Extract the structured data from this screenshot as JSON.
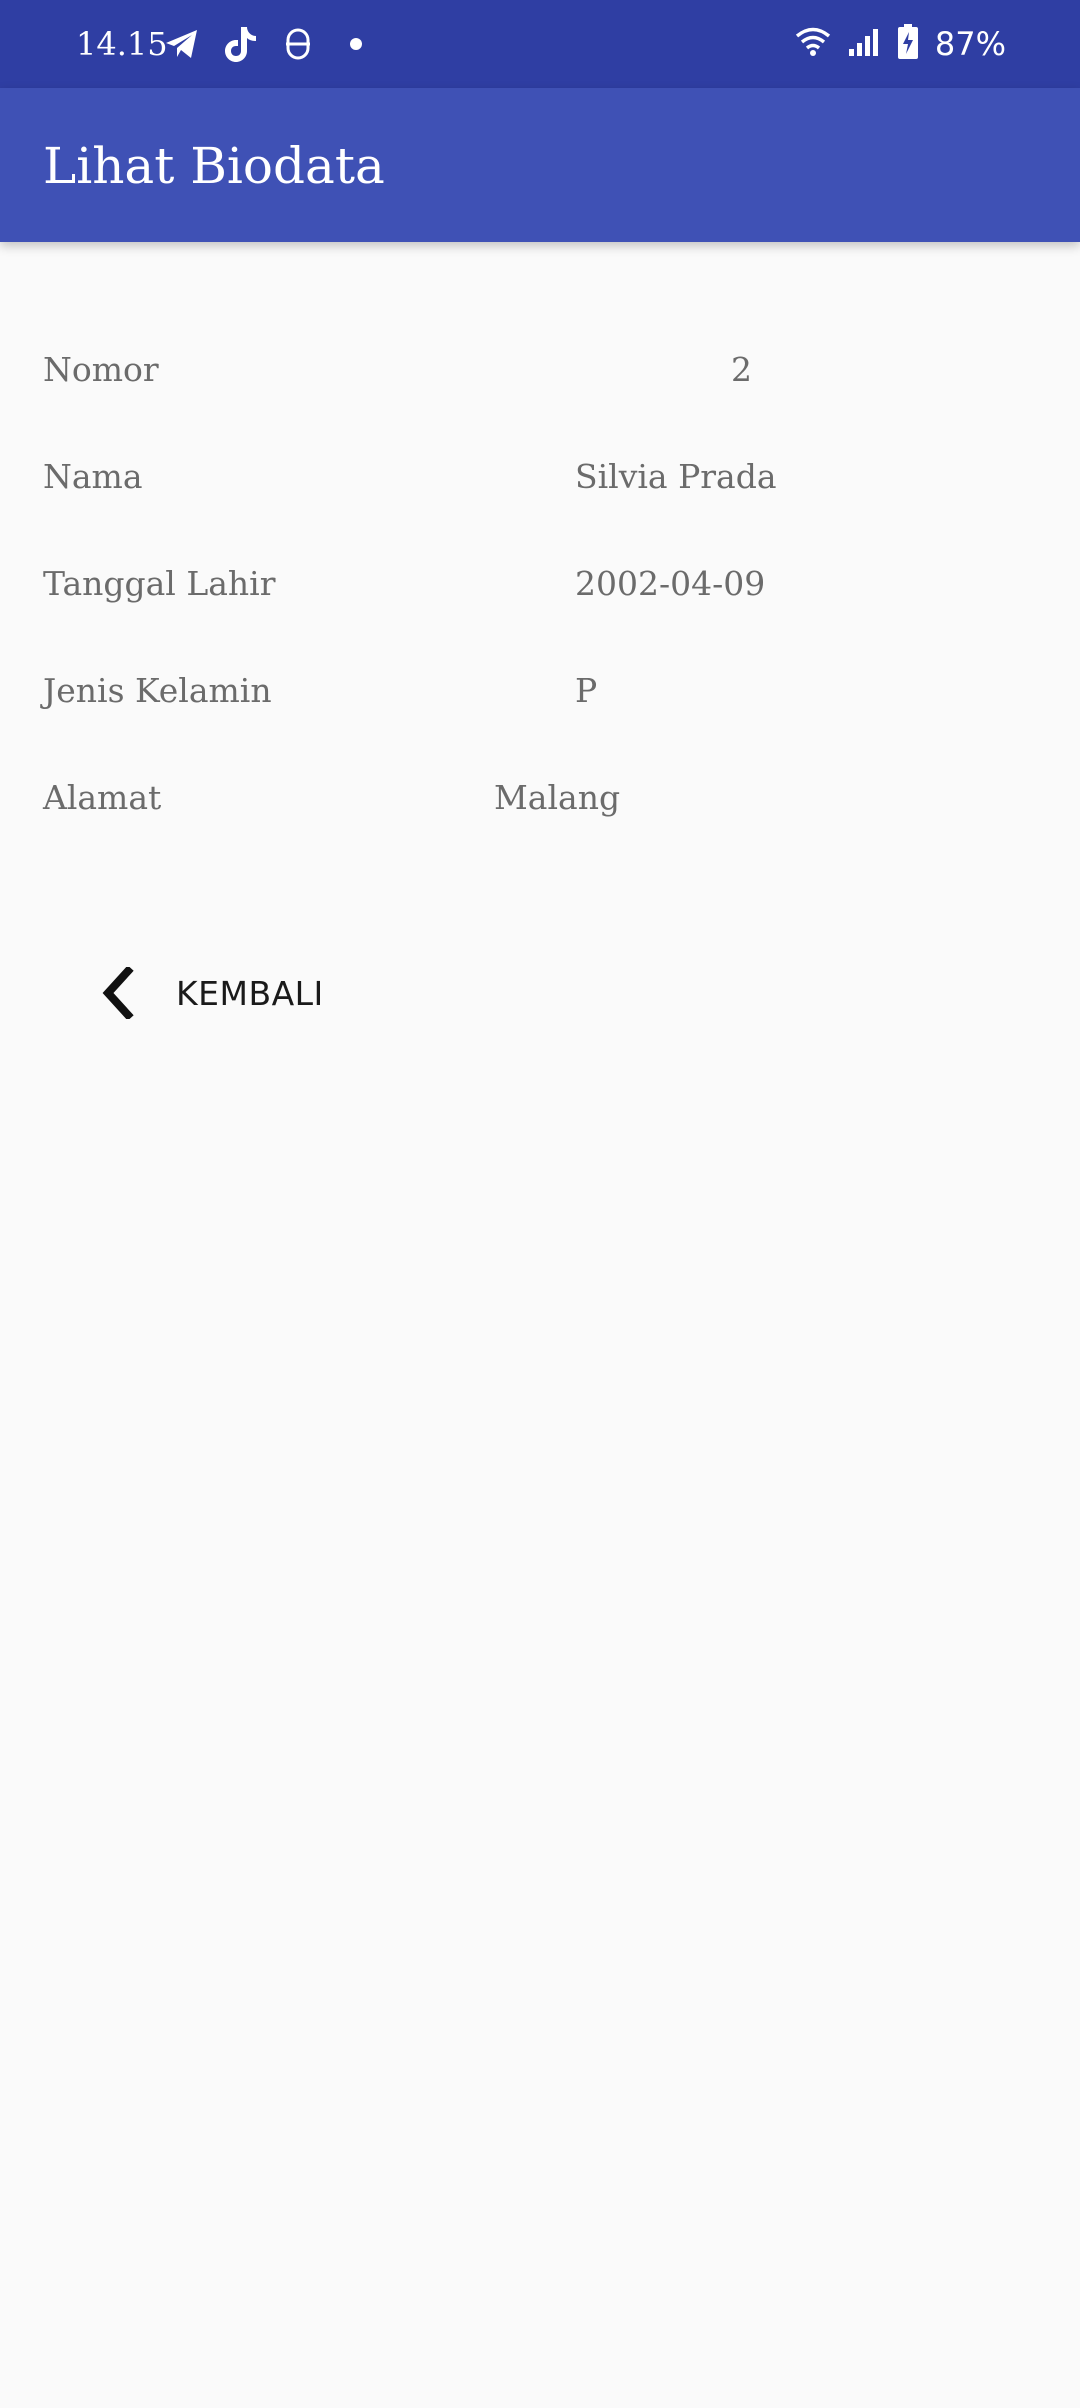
{
  "status_bar": {
    "time": "14.15",
    "battery_percent": "87%",
    "left_icons": [
      "telegram-icon",
      "tiktok-icon",
      "app-s-icon",
      "notification-dot-icon"
    ],
    "right_icons": [
      "wifi-icon",
      "signal-icon",
      "battery-charging-icon"
    ],
    "background": "#2f3ea3"
  },
  "app_bar": {
    "title": "Lihat Biodata",
    "background": "#3f51b5"
  },
  "biodata": {
    "nomor": {
      "label": "Nomor",
      "value": "2"
    },
    "nama": {
      "label": "Nama",
      "value": "Silvia Prada"
    },
    "tanggal_lahir": {
      "label": "Tanggal Lahir",
      "value": "2002-04-09"
    },
    "jenis_kelamin": {
      "label": "Jenis Kelamin",
      "value": "P"
    },
    "alamat": {
      "label": "Alamat",
      "value": "Malang"
    }
  },
  "actions": {
    "back_label": "KEMBALI",
    "back_icon": "chevron-left-icon"
  }
}
